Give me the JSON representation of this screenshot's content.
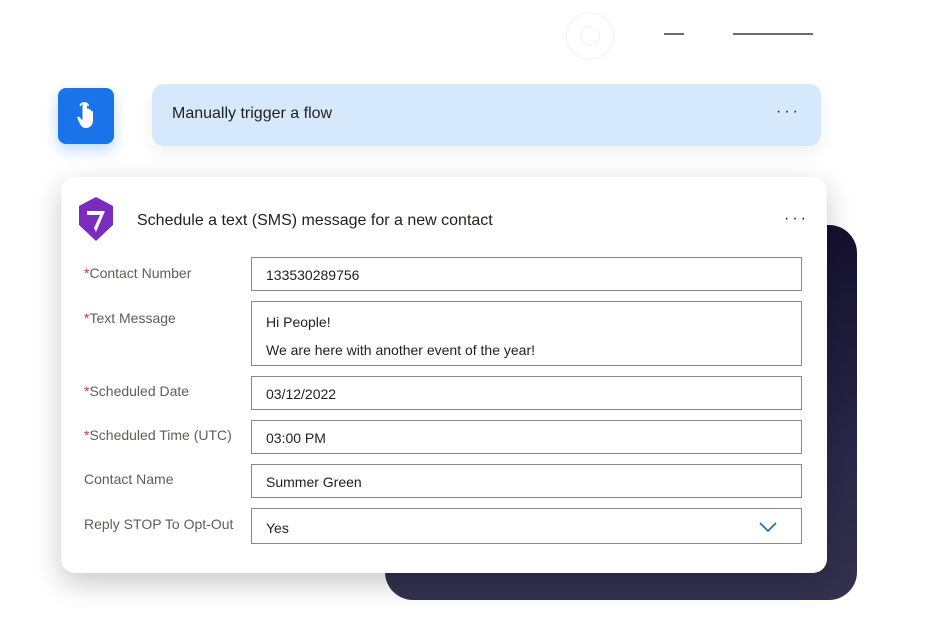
{
  "trigger": {
    "title": "Manually trigger a flow",
    "more": "···"
  },
  "action": {
    "title": "Schedule a text (SMS) message for a new contact",
    "more": "···",
    "required_marker": "*",
    "fields": [
      {
        "label": "Contact Number",
        "required": true,
        "value": "133530289756"
      },
      {
        "label": "Text Message",
        "required": true,
        "value_lines": [
          "Hi People!",
          "We are here with another event of the year!"
        ]
      },
      {
        "label": "Scheduled Date",
        "required": true,
        "value": "03/12/2022"
      },
      {
        "label": "Scheduled Time (UTC)",
        "required": true,
        "value": "03:00 PM"
      },
      {
        "label": "Contact Name",
        "required": false,
        "value": "Summer Green"
      },
      {
        "label": "Reply STOP To Opt-Out",
        "required": false,
        "value": "Yes",
        "type": "dropdown"
      }
    ]
  },
  "colors": {
    "trigger_icon_bg": "#1a73e8",
    "trigger_bar_bg": "#d6e8fb",
    "required": "#d13438",
    "logo": "#7b2cbf",
    "chevron": "#0f6cbd"
  },
  "icons": [
    "hand-pointer-icon",
    "app-logo-icon",
    "chevron-down-icon",
    "more-options-icon"
  ]
}
